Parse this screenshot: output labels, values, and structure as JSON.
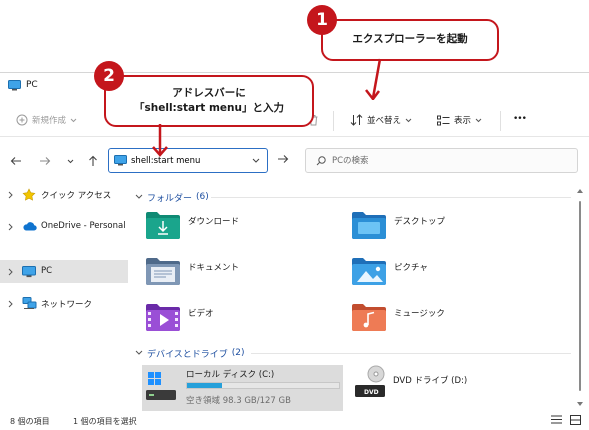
{
  "window": {
    "title": "PC",
    "commandbar": {
      "new_label": "新規作成",
      "sort_label": "並べ替え",
      "view_label": "表示",
      "more_label": "•••"
    },
    "address": {
      "value": "shell:start menu"
    },
    "search": {
      "placeholder": "PCの検索"
    },
    "sidebar": {
      "items": [
        {
          "label": "クイック アクセス",
          "icon": "star-icon"
        },
        {
          "label": "OneDrive - Personal",
          "icon": "cloud-icon"
        },
        {
          "label": "PC",
          "icon": "pc-icon"
        },
        {
          "label": "ネットワーク",
          "icon": "network-icon"
        }
      ]
    },
    "content": {
      "folders_group": {
        "title": "フォルダー",
        "count": "(6)"
      },
      "folders": [
        {
          "label": "ダウンロード",
          "icon": "downloads-icon",
          "color": "#1aa58c"
        },
        {
          "label": "デスクトップ",
          "icon": "desktop-icon",
          "color": "#2b8fd6"
        },
        {
          "label": "ドキュメント",
          "icon": "documents-icon",
          "color": "#6a86a8"
        },
        {
          "label": "ピクチャ",
          "icon": "pictures-icon",
          "color": "#2b8fd6"
        },
        {
          "label": "ビデオ",
          "icon": "videos-icon",
          "color": "#8a3fc7"
        },
        {
          "label": "ミュージック",
          "icon": "music-icon",
          "color": "#e66a4a"
        }
      ],
      "drives_group": {
        "title": "デバイスとドライブ",
        "count": "(2)"
      },
      "drives": [
        {
          "name": "ローカル ディスク (C:)",
          "space": "空き領域 98.3 GB/127 GB",
          "used_fraction": 0.23
        },
        {
          "name": "DVD ドライブ (D:)",
          "disc_label": "DVD"
        }
      ]
    },
    "status": {
      "item_count": "8 個の項目",
      "selected": "1 個の項目を選択"
    }
  },
  "callouts": [
    {
      "number": "1",
      "text": "エクスプローラーを起動"
    },
    {
      "number": "2",
      "line1": "アドレスバーに",
      "line2": "「shell:start menu」と入力"
    }
  ],
  "colors": {
    "callout_red": "#c4161c",
    "accent_blue": "#2c6fc4",
    "group_blue": "#1e4fa0"
  }
}
